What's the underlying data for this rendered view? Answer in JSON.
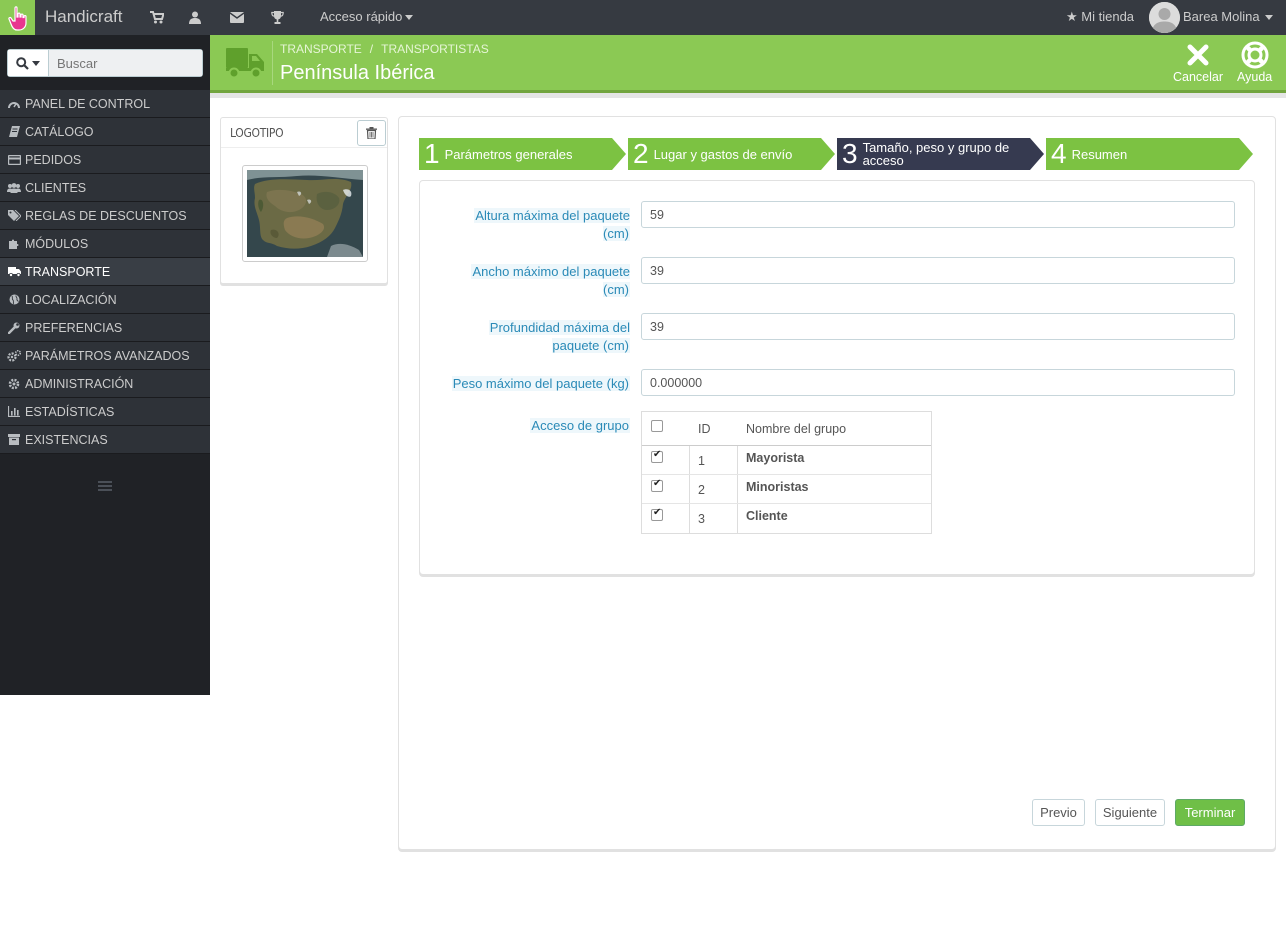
{
  "topbar": {
    "brand": "Handicraft",
    "icons": [
      "cart-icon",
      "user-icon",
      "envelope-icon",
      "trophy-icon"
    ],
    "quick_access": "Acceso rápido",
    "store_link": "Mi tienda",
    "user_name": "Barea Molina"
  },
  "sidebar": {
    "search_placeholder": "Buscar",
    "items": [
      {
        "label": "PANEL DE CONTROL",
        "icon": "dashboard-icon"
      },
      {
        "label": "CATÁLOGO",
        "icon": "book-icon"
      },
      {
        "label": "PEDIDOS",
        "icon": "credit-card-icon"
      },
      {
        "label": "CLIENTES",
        "icon": "users-icon"
      },
      {
        "label": "REGLAS DE DESCUENTOS",
        "icon": "tags-icon"
      },
      {
        "label": "MÓDULOS",
        "icon": "puzzle-icon"
      },
      {
        "label": "TRANSPORTE",
        "icon": "truck-icon"
      },
      {
        "label": "LOCALIZACIÓN",
        "icon": "globe-icon"
      },
      {
        "label": "PREFERENCIAS",
        "icon": "wrench-icon"
      },
      {
        "label": "PARÁMETROS AVANZADOS",
        "icon": "cogs-icon"
      },
      {
        "label": "ADMINISTRACIÓN",
        "icon": "cog-icon"
      },
      {
        "label": "ESTADÍSTICAS",
        "icon": "bar-chart-icon"
      },
      {
        "label": "EXISTENCIAS",
        "icon": "archive-icon"
      }
    ],
    "active_index": 6
  },
  "header": {
    "breadcrumb": [
      "TRANSPORTE",
      "TRANSPORTISTAS"
    ],
    "title": "Península Ibérica",
    "cancel_label": "Cancelar",
    "help_label": "Ayuda"
  },
  "logo_panel": {
    "title": "LOGOTIPO"
  },
  "steps": [
    {
      "num": "1",
      "label": "Parámetros generales",
      "state": "done"
    },
    {
      "num": "2",
      "label": "Lugar y gastos de envío",
      "state": "done"
    },
    {
      "num": "3",
      "label": "Tamaño, peso y grupo de acceso",
      "state": "current"
    },
    {
      "num": "4",
      "label": "Resumen",
      "state": "done"
    }
  ],
  "form": {
    "fields": [
      {
        "label": "Altura máxima del paquete (cm)",
        "value": "59"
      },
      {
        "label": "Ancho máximo del paquete (cm)",
        "value": "39"
      },
      {
        "label": "Profundidad máxima del paquete (cm)",
        "value": "39"
      },
      {
        "label": "Peso máximo del paquete (kg)",
        "value": "0.000000"
      }
    ],
    "group_label": "Acceso de grupo",
    "group_table": {
      "col_id": "ID",
      "col_name": "Nombre del grupo",
      "rows": [
        {
          "id": "1",
          "name": "Mayorista",
          "checked": true
        },
        {
          "id": "2",
          "name": "Minoristas",
          "checked": true
        },
        {
          "id": "3",
          "name": "Cliente",
          "checked": true
        }
      ]
    }
  },
  "buttons": {
    "prev": "Previo",
    "next": "Siguiente",
    "finish": "Terminar"
  },
  "colors": {
    "topbar": "#363a41",
    "accent_green": "#8bc954",
    "sidebar": "#2e3238",
    "step_current": "#363a50",
    "label_blue": "#2a8ab7"
  }
}
